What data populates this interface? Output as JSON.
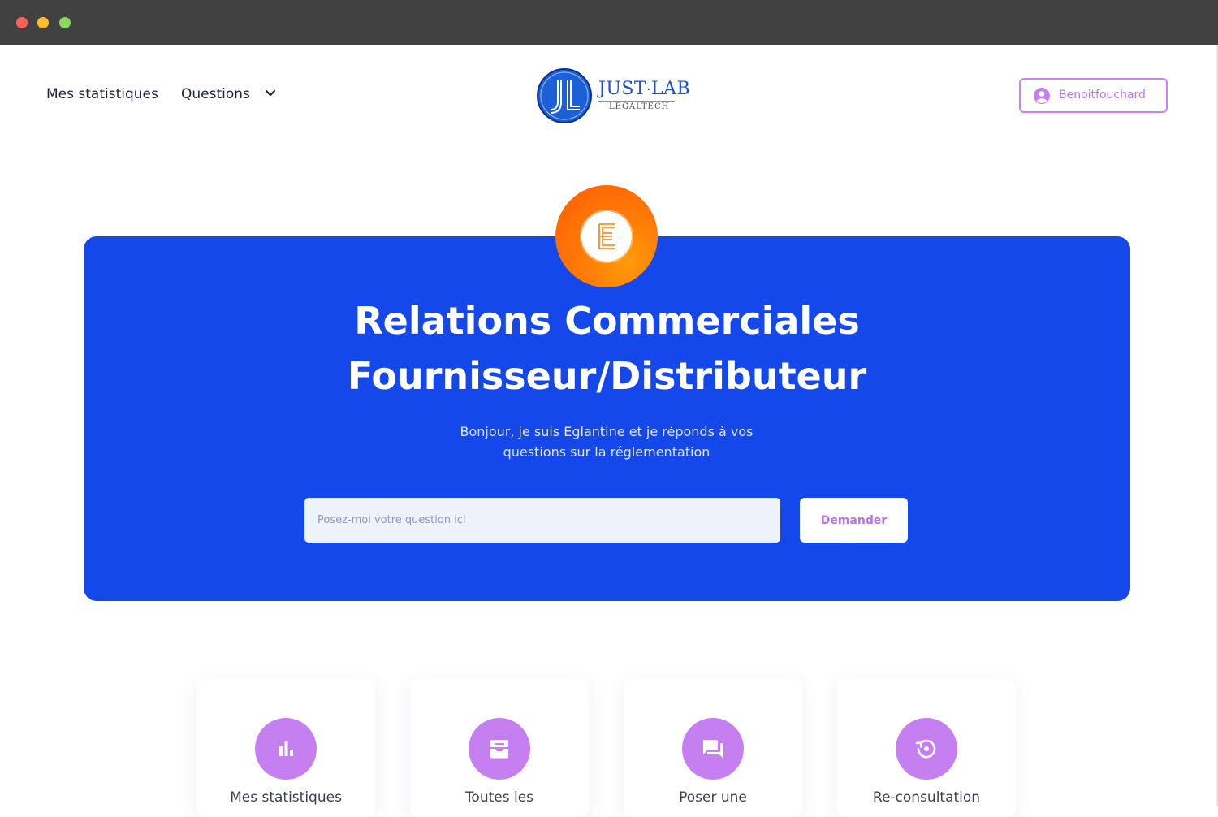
{
  "nav": {
    "stats_label": "Mes statistiques",
    "questions_label": "Questions"
  },
  "logo": {
    "text_main": "JUST",
    "text_sep": "·",
    "text_end": "LAB",
    "subtitle": "LEGALTECH",
    "monogram": "JL"
  },
  "user": {
    "name": "Benoitfouchard",
    "icon": "account-circle-icon"
  },
  "hero": {
    "avatar_letter": "E",
    "title_line1": "Relations Commerciales",
    "title_line2": "Fournisseur/Distributeur",
    "subtitle_line1": "Bonjour, je suis Eglantine et je réponds à vos",
    "subtitle_line2": "questions sur la réglementation",
    "input_placeholder": "Posez-moi votre question ici",
    "ask_label": "Demander"
  },
  "cards": [
    {
      "label": "Mes statistiques",
      "icon": "bar-chart-icon"
    },
    {
      "label": "Toutes les",
      "icon": "inbox-archive-icon"
    },
    {
      "label": "Poser une",
      "icon": "chat-bubbles-icon"
    },
    {
      "label": "Re-consultation",
      "icon": "history-icon"
    }
  ],
  "colors": {
    "hero_blue": "#1448ea",
    "accent_purple": "#c57ff0",
    "avatar_orange": "#ff7a06",
    "titlebar": "#414141"
  }
}
